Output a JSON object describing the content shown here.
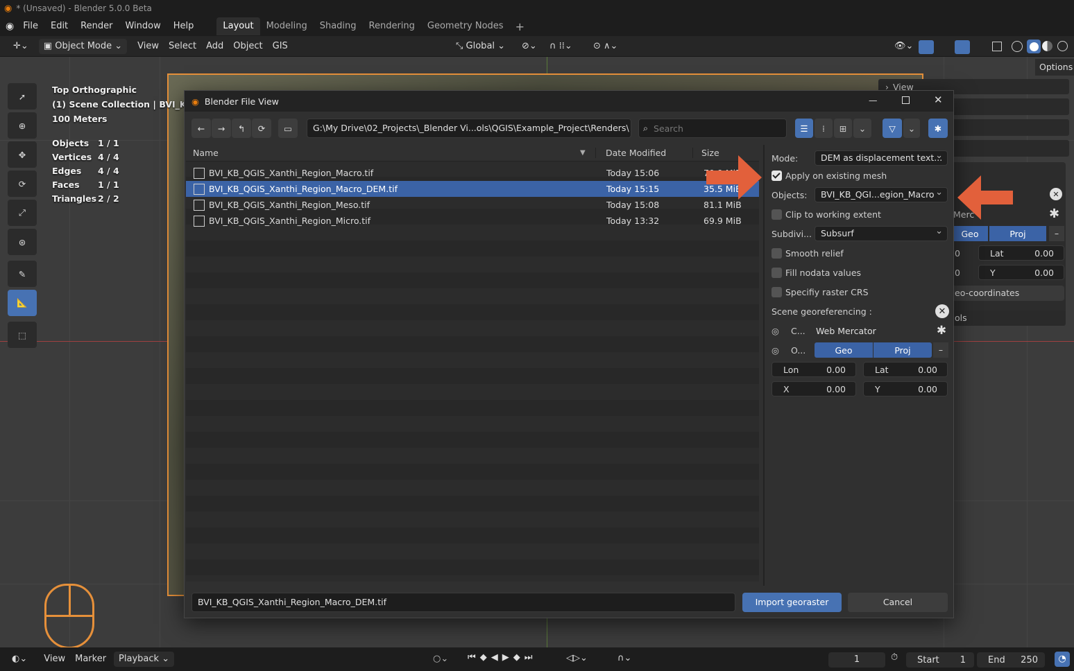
{
  "titlebar": {
    "title": "* (Unsaved) - Blender 5.0.0 Beta"
  },
  "menus": [
    "File",
    "Edit",
    "Render",
    "Window",
    "Help"
  ],
  "workspaces": [
    "Layout",
    "Modeling",
    "Shading",
    "Rendering",
    "Geometry Nodes"
  ],
  "header": {
    "mode": "Object Mode",
    "menus": [
      "View",
      "Select",
      "Add",
      "Object",
      "GIS"
    ],
    "orientation": "Global",
    "options": "Options"
  },
  "overlay": {
    "view_name": "Top Orthographic",
    "collection": "(1) Scene Collection | BVI_KB_Q",
    "scale": "100 Meters",
    "stats": [
      {
        "label": "Objects",
        "value": "1 / 1"
      },
      {
        "label": "Vertices",
        "value": "4 / 4"
      },
      {
        "label": "Edges",
        "value": "4 / 4"
      },
      {
        "label": "Faces",
        "value": "1 / 1"
      },
      {
        "label": "Triangles",
        "value": "2 / 2"
      }
    ]
  },
  "npanel": {
    "view_label": "View",
    "crs_partial": "Merc",
    "geo": "Geo",
    "proj": "Proj",
    "lat_label": "Lat",
    "lat_value": "0.00",
    "y_label": "Y",
    "y_value": "0.00",
    "zero1": "0",
    "zero2": "0",
    "coords_partial": "eo-coordinates",
    "tools_partial": "ols"
  },
  "dialog": {
    "title": "Blender File View",
    "path": "G:\\My Drive\\02_Projects\\_Blender Vi...ols\\QGIS\\Example_Project\\Renders\\",
    "search_placeholder": "Search",
    "columns": {
      "name": "Name",
      "date": "Date Modified",
      "size": "Size"
    },
    "files": [
      {
        "name": "BVI_KB_QGIS_Xanthi_Region_Macro.tif",
        "date": "Today 15:06",
        "size": "70.9 MiB",
        "selected": false
      },
      {
        "name": "BVI_KB_QGIS_Xanthi_Region_Macro_DEM.tif",
        "date": "Today 15:15",
        "size": "35.5 MiB",
        "selected": true
      },
      {
        "name": "BVI_KB_QGIS_Xanthi_Region_Meso.tif",
        "date": "Today 15:08",
        "size": "81.1 MiB",
        "selected": false
      },
      {
        "name": "BVI_KB_QGIS_Xanthi_Region_Micro.tif",
        "date": "Today 13:32",
        "size": "69.9 MiB",
        "selected": false
      }
    ],
    "filename": "BVI_KB_QGIS_Xanthi_Region_Macro_DEM.tif",
    "import_label": "Import georaster",
    "cancel_label": "Cancel",
    "sidebar": {
      "mode_label": "Mode:",
      "mode_value": "DEM as displacement text...",
      "apply_label": "Apply on existing mesh",
      "objects_label": "Objects:",
      "objects_value": "BVI_KB_QGI...egion_Macro",
      "clip_label": "Clip to working extent",
      "subdiv_label": "Subdivi...",
      "subdiv_value": "Subsurf",
      "smooth_label": "Smooth relief",
      "fill_label": "Fill nodata values",
      "crs_label": "Specifiy raster CRS",
      "scene_geo_label": "Scene georeferencing :",
      "c_label": "C...",
      "crs_value": "Web Mercator",
      "o_label": "O...",
      "geo": "Geo",
      "proj": "Proj",
      "lon_label": "Lon",
      "lon_value": "0.00",
      "lat_label": "Lat",
      "lat_value": "0.00",
      "x_label": "X",
      "x_value": "0.00",
      "y_label": "Y",
      "y_value": "0.00"
    }
  },
  "timeline": {
    "menus": [
      "View",
      "Marker",
      "Playback"
    ],
    "current_frame": "1",
    "start_label": "Start",
    "start_value": "1",
    "end_label": "End",
    "end_value": "250"
  },
  "colors": {
    "accent": "#4772b3",
    "selection": "#3b63a6",
    "arrow": "#e2603b",
    "frame": "#e6903a"
  }
}
